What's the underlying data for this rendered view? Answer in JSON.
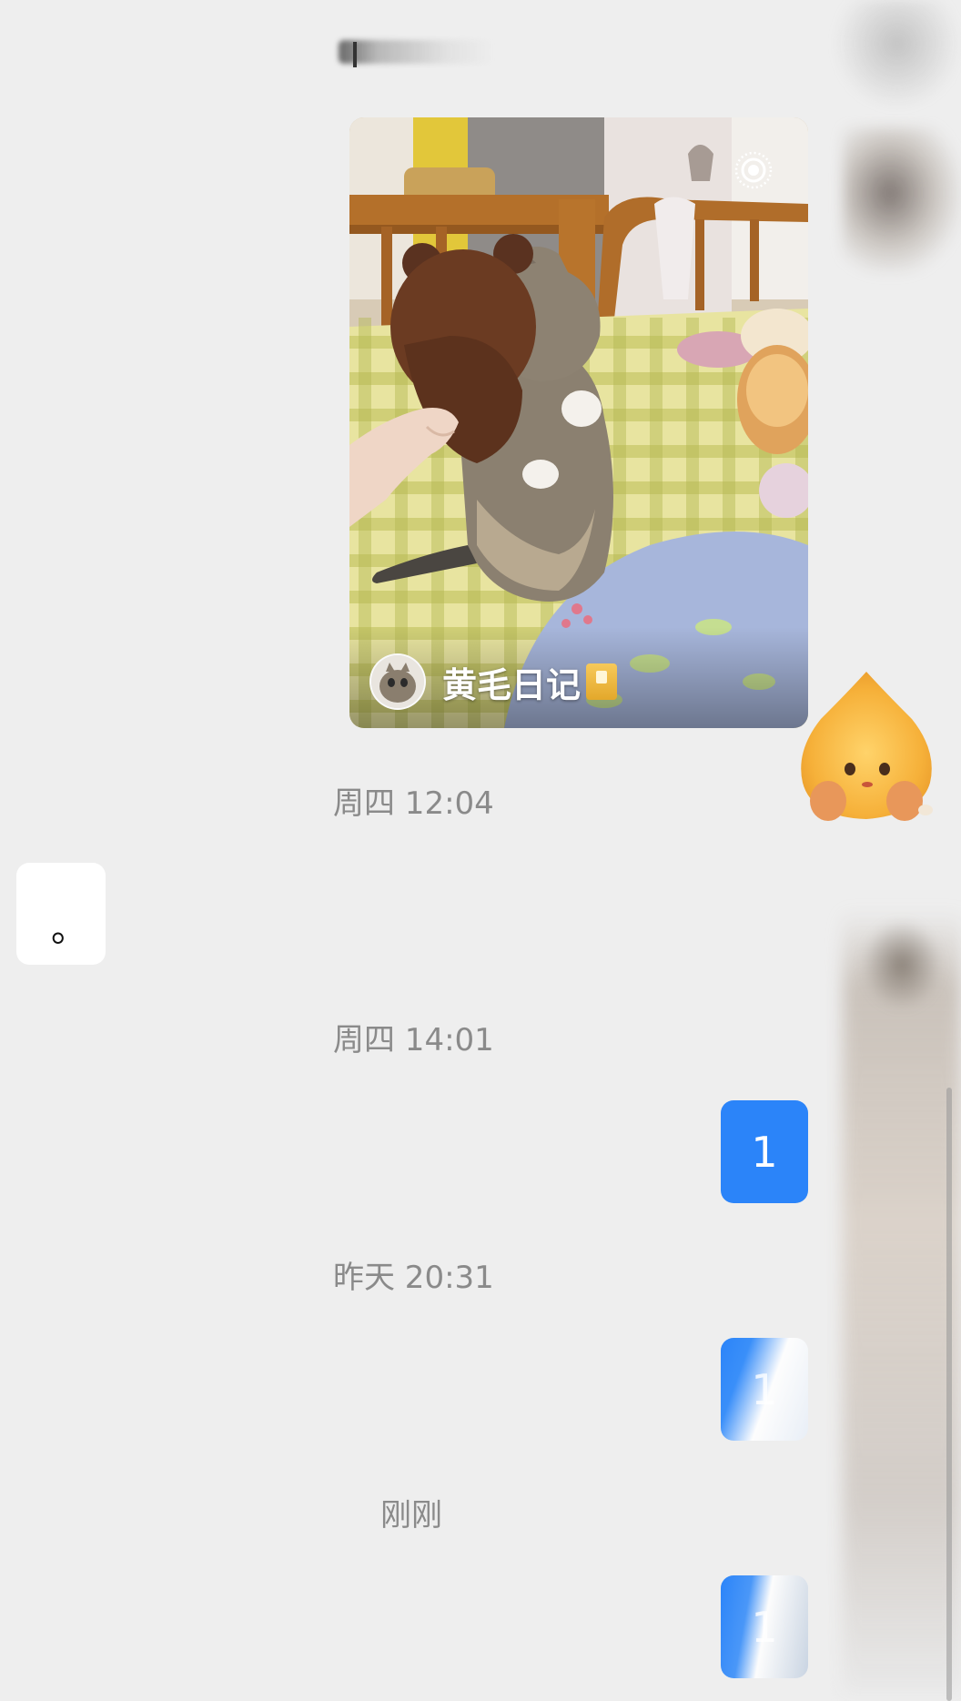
{
  "chat": {
    "header_blurred": "",
    "video_card": {
      "author": "黄毛日记",
      "live_icon": "live-photo-icon",
      "diary_icon": "notebook-emoji"
    },
    "messages": [
      {
        "type": "time",
        "text": "周四 12:04"
      },
      {
        "type": "incoming",
        "text": "。"
      },
      {
        "type": "time",
        "text": "周四 14:01"
      },
      {
        "type": "outgoing",
        "text": "1"
      },
      {
        "type": "time",
        "text": "昨天 20:31"
      },
      {
        "type": "outgoing",
        "text": "1"
      },
      {
        "type": "time",
        "text": "刚刚"
      },
      {
        "type": "outgoing",
        "text": "1"
      }
    ]
  },
  "colors": {
    "background": "#eeeeee",
    "outgoing_bubble": "#2b84f9",
    "incoming_bubble": "#ffffff",
    "timestamp_text": "#8a8a8a"
  }
}
